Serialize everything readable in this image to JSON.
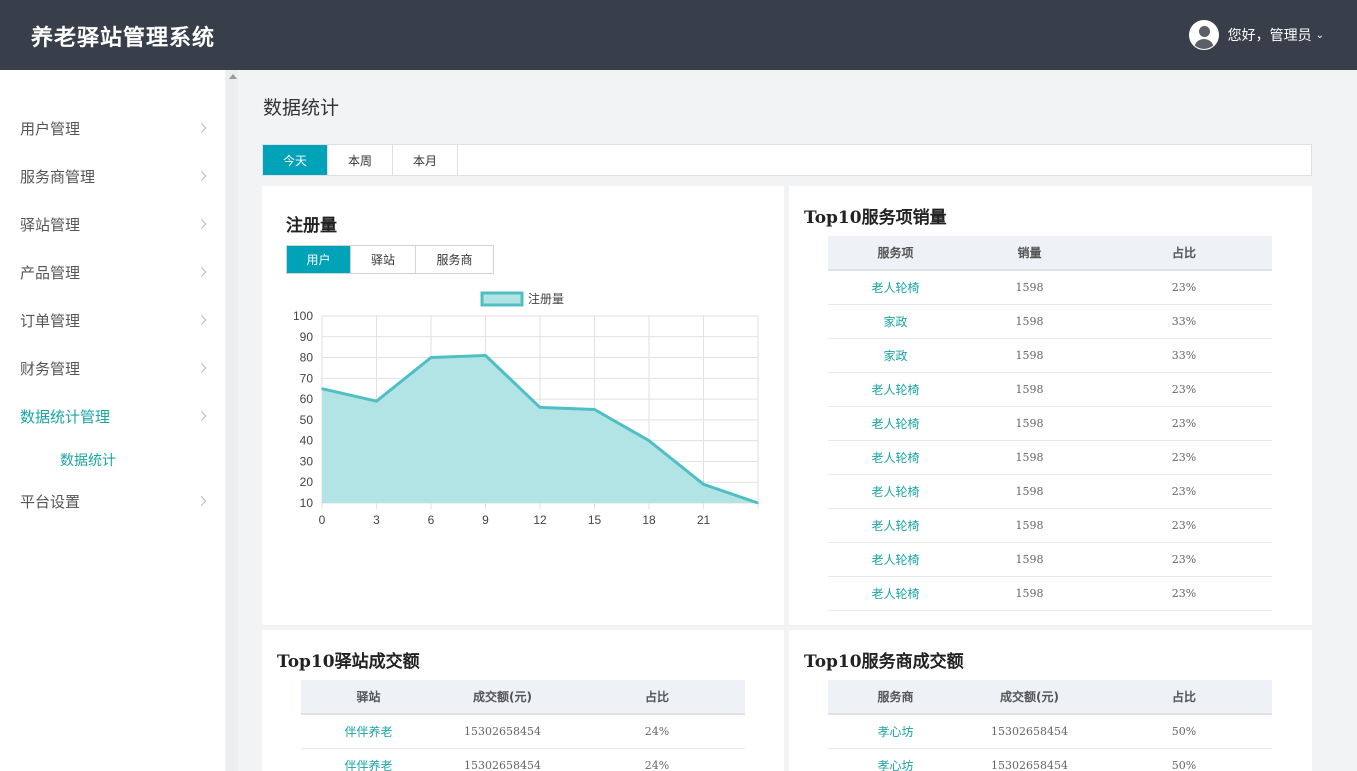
{
  "header": {
    "app_title": "养老驿站管理系统",
    "greeting": "您好，管理员"
  },
  "sidebar": {
    "items": [
      {
        "label": "用户管理"
      },
      {
        "label": "服务商管理"
      },
      {
        "label": "驿站管理"
      },
      {
        "label": "产品管理"
      },
      {
        "label": "订单管理"
      },
      {
        "label": "财务管理"
      },
      {
        "label": "数据统计管理",
        "active": true
      },
      {
        "label": "平台设置"
      }
    ],
    "sub_item": "数据统计"
  },
  "main": {
    "page_title": "数据统计",
    "range_tabs": [
      "今天",
      "本周",
      "本月"
    ],
    "active_range": "今天"
  },
  "registration_panel": {
    "title": "注册量",
    "tabs": [
      "用户",
      "驿站",
      "服务商"
    ],
    "active_tab": "用户"
  },
  "chart_data": {
    "type": "area",
    "title": "注册量",
    "series": [
      {
        "name": "注册量",
        "x": [
          0,
          3,
          6,
          9,
          12,
          15,
          18,
          21,
          24
        ],
        "values": [
          65,
          59,
          80,
          81,
          56,
          55,
          40,
          19,
          10
        ]
      }
    ],
    "x_ticks": [
      0,
      3,
      6,
      9,
      12,
      15,
      18,
      21
    ],
    "y_ticks": [
      10,
      20,
      30,
      40,
      50,
      60,
      70,
      80,
      90,
      100
    ],
    "ylim": [
      10,
      100
    ],
    "xlim": [
      0,
      24
    ],
    "legend": "top-center",
    "grid": true,
    "colors": {
      "line": "#4fbfc4",
      "fill": "#b3e4e5"
    }
  },
  "top_services": {
    "title": "Top10服务项销量",
    "columns": [
      "服务项",
      "销量",
      "占比"
    ],
    "rows": [
      [
        "老人轮椅",
        "1598",
        "23%"
      ],
      [
        "家政",
        "1598",
        "33%"
      ],
      [
        "家政",
        "1598",
        "33%"
      ],
      [
        "老人轮椅",
        "1598",
        "23%"
      ],
      [
        "老人轮椅",
        "1598",
        "23%"
      ],
      [
        "老人轮椅",
        "1598",
        "23%"
      ],
      [
        "老人轮椅",
        "1598",
        "23%"
      ],
      [
        "老人轮椅",
        "1598",
        "23%"
      ],
      [
        "老人轮椅",
        "1598",
        "23%"
      ],
      [
        "老人轮椅",
        "1598",
        "23%"
      ]
    ]
  },
  "top_stations": {
    "title": "Top10驿站成交额",
    "columns": [
      "驿站",
      "成交额(元)",
      "占比"
    ],
    "rows": [
      [
        "伴伴养老",
        "15302658454",
        "24%"
      ],
      [
        "伴伴养老",
        "15302658454",
        "24%"
      ]
    ]
  },
  "top_providers": {
    "title": "Top10服务商成交额",
    "columns": [
      "服务商",
      "成交额(元)",
      "占比"
    ],
    "rows": [
      [
        "孝心坊",
        "15302658454",
        "50%"
      ],
      [
        "孝心坊",
        "15302658454",
        "50%"
      ]
    ]
  }
}
